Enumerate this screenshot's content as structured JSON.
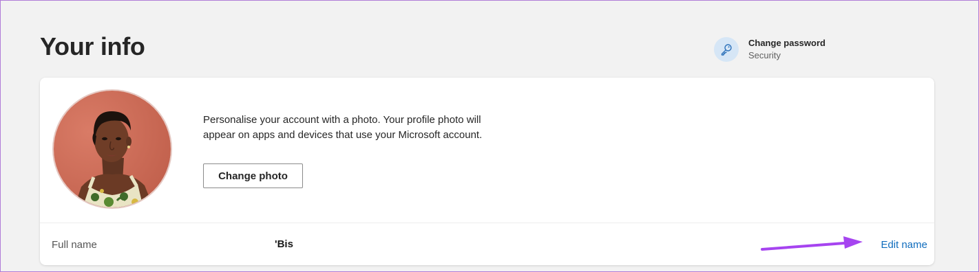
{
  "page": {
    "title": "Your info"
  },
  "security_link": {
    "title": "Change password",
    "subtitle": "Security",
    "icon": "key-icon"
  },
  "profile_card": {
    "avatar": "profile-photo",
    "photo_description": "Personalise your account with a photo. Your profile photo will appear on apps and devices that use your Microsoft account.",
    "change_photo_label": "Change photo"
  },
  "name_row": {
    "label": "Full name",
    "value": "'Bis",
    "edit_label": "Edit name"
  },
  "colors": {
    "background": "#f2f2f2",
    "card": "#ffffff",
    "link": "#0f6cbd",
    "annotation_arrow": "#a644f0",
    "key_circle": "#d6e6f6"
  }
}
